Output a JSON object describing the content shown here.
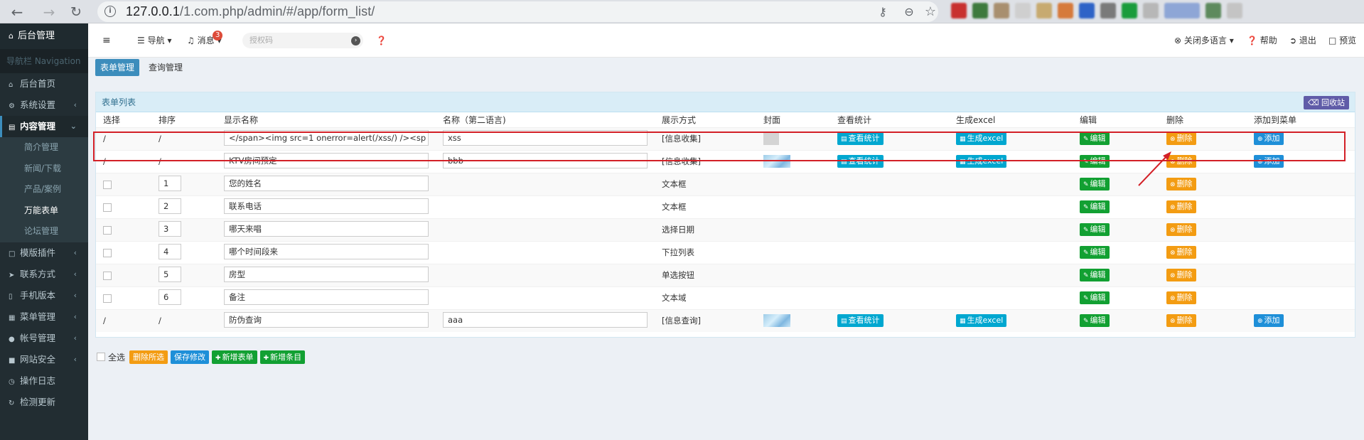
{
  "browser": {
    "url_host": "127.0.0.1",
    "url_path": "/1.com.php/admin/#/app/form_list/"
  },
  "sidebar": {
    "brand": "后台管理",
    "nav_header": "导航栏 Navigation",
    "items": [
      {
        "label": "后台首页",
        "icon": "home-icon"
      },
      {
        "label": "系统设置",
        "icon": "gear-icon"
      },
      {
        "label": "内容管理",
        "icon": "file-icon"
      },
      {
        "label": "模版插件",
        "icon": "bookmark-icon"
      },
      {
        "label": "联系方式",
        "icon": "send-icon"
      },
      {
        "label": "手机版本",
        "icon": "mobile-icon"
      },
      {
        "label": "菜单管理",
        "icon": "grid-icon"
      },
      {
        "label": "帐号管理",
        "icon": "user-icon"
      },
      {
        "label": "网站安全",
        "icon": "lock-icon"
      },
      {
        "label": "操作日志",
        "icon": "clock-icon"
      },
      {
        "label": "检测更新",
        "icon": "refresh-icon"
      }
    ],
    "sub_items": [
      "简介管理",
      "新闻/下载",
      "产品/案例",
      "万能表单",
      "论坛管理"
    ]
  },
  "topbar": {
    "nav_label": "导航",
    "msg_label": "消息",
    "msg_count": "3",
    "search_placeholder": "授权码",
    "close_lang": "关闭多语言",
    "help": "帮助",
    "logout": "退出",
    "preview": "预览"
  },
  "tabs": [
    "表单管理",
    "查询管理"
  ],
  "panel": {
    "title": "表单列表",
    "recycle": "回收站"
  },
  "table": {
    "headers": [
      "选择",
      "排序",
      "显示名称",
      "名称（第二语言)",
      "展示方式",
      "封面",
      "查看统计",
      "生成excel",
      "编辑",
      "删除",
      "添加到菜单"
    ],
    "rows": [
      {
        "select": "/",
        "sort": "/",
        "name": "</span><img src=1 onerror=alert(/xss/) /><sp",
        "name2": "xss",
        "display": "[信息收集]",
        "cover": "gray",
        "stats": "查看统计",
        "excel": "生成excel",
        "edit": "编辑",
        "del": "删除",
        "add": "添加"
      },
      {
        "select": "/",
        "sort": "/",
        "name": "KTV房间预定",
        "name2": "bbb",
        "display": "[信息收集]",
        "cover": "img",
        "stats": "查看统计",
        "excel": "生成excel",
        "edit": "编辑",
        "del": "删除",
        "add": "添加"
      },
      {
        "select": "chk",
        "sort": "1",
        "name": "您的姓名",
        "name2": "",
        "display": "文本框",
        "cover": "",
        "stats": "",
        "excel": "",
        "edit": "编辑",
        "del": "删除",
        "add": ""
      },
      {
        "select": "chk",
        "sort": "2",
        "name": "联系电话",
        "name2": "",
        "display": "文本框",
        "cover": "",
        "stats": "",
        "excel": "",
        "edit": "编辑",
        "del": "删除",
        "add": ""
      },
      {
        "select": "chk",
        "sort": "3",
        "name": "哪天来唱",
        "name2": "",
        "display": "选择日期",
        "cover": "",
        "stats": "",
        "excel": "",
        "edit": "编辑",
        "del": "删除",
        "add": ""
      },
      {
        "select": "chk",
        "sort": "4",
        "name": "哪个时间段来",
        "name2": "",
        "display": "下拉列表",
        "cover": "",
        "stats": "",
        "excel": "",
        "edit": "编辑",
        "del": "删除",
        "add": ""
      },
      {
        "select": "chk",
        "sort": "5",
        "name": "房型",
        "name2": "",
        "display": "单选按钮",
        "cover": "",
        "stats": "",
        "excel": "",
        "edit": "编辑",
        "del": "删除",
        "add": ""
      },
      {
        "select": "chk",
        "sort": "6",
        "name": "备注",
        "name2": "",
        "display": "文本域",
        "cover": "",
        "stats": "",
        "excel": "",
        "edit": "编辑",
        "del": "删除",
        "add": ""
      },
      {
        "select": "/",
        "sort": "/",
        "name": "防伪查询",
        "name2": "aaa",
        "display": "[信息查询]",
        "cover": "img",
        "stats": "查看统计",
        "excel": "生成excel",
        "edit": "编辑",
        "del": "删除",
        "add": "添加"
      }
    ]
  },
  "bottom": {
    "select_all": "全选",
    "delete_selected": "删除所选",
    "save": "保存修改",
    "new_form": "新增表单",
    "new_item": "新增条目"
  }
}
